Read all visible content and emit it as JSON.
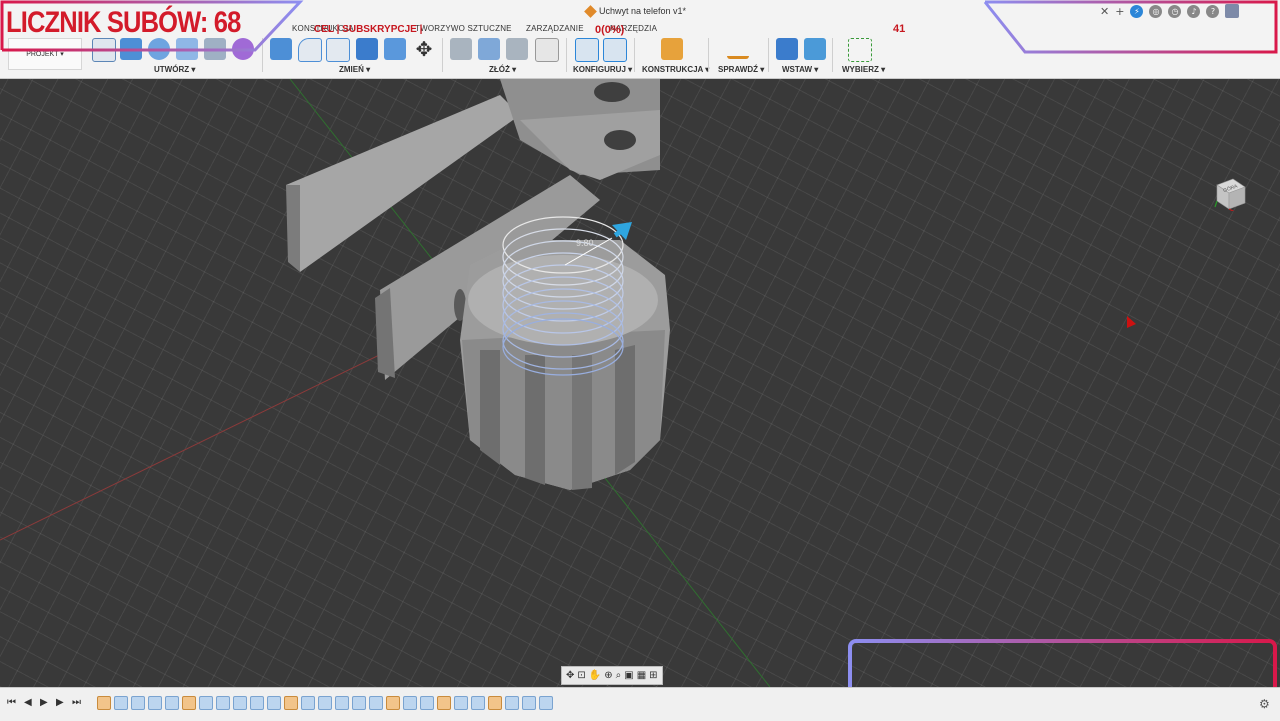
{
  "window": {
    "doc_title": "Uchwyt na telefon v1*"
  },
  "overlay": {
    "sub_counter": "LICZNIK SUBÓW: 68",
    "goal_label": "CEL | SUBSKRYPCJE |",
    "goal_percent": "0(0%)",
    "goal_value": "41"
  },
  "tabs": [
    "KONSTRUKCJA",
    "TWORZYWO SZTUCZNE",
    "ZARZĄDZANIE",
    "NARZĘDZIA"
  ],
  "projekt_label": "PROJEKT ▾",
  "toolbar_groups": [
    {
      "label": "UTWÓRZ ▾"
    },
    {
      "label": "ZMIEŃ ▾"
    },
    {
      "label": "ZŁÓŻ ▾"
    },
    {
      "label": "KONFIGURUJ ▾"
    },
    {
      "label": "KONSTRUKCJA ▾"
    },
    {
      "label": "SPRAWDŹ ▾"
    },
    {
      "label": "WSTAW ▾"
    },
    {
      "label": "WYBIERZ ▾"
    }
  ],
  "dimension_label": "9.80",
  "viewcube_label": "GÓRA",
  "colors": {
    "accent": "#2c86d8",
    "overlay_red": "#d31b2a",
    "viewport_bg": "#393939"
  }
}
